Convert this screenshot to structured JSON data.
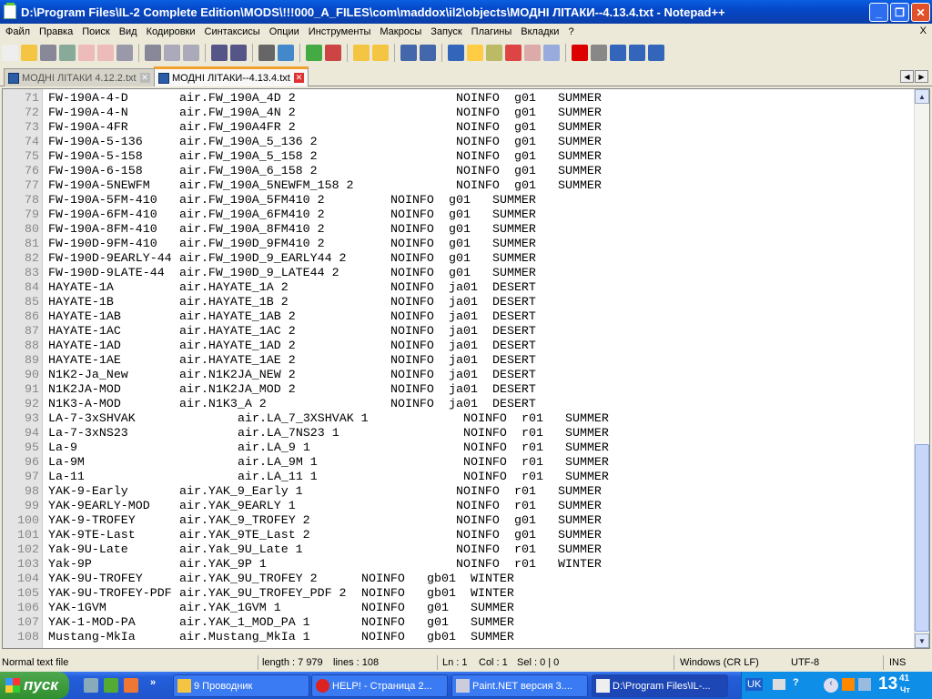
{
  "window": {
    "title": "D:\\Program Files\\IL-2 Complete Edition\\MODS\\!!!000_A_FILES\\com\\maddox\\il2\\objects\\МОДНІ ЛІТАКИ--4.13.4.txt - Notepad++",
    "minimize": "_",
    "restore": "❐",
    "close": "✕"
  },
  "menu": [
    "Файл",
    "Правка",
    "Поиск",
    "Вид",
    "Кодировки",
    "Синтаксисы",
    "Опции",
    "Инструменты",
    "Макросы",
    "Запуск",
    "Плагины",
    "Вкладки",
    "?"
  ],
  "menu_close": "X",
  "toolbar": [
    "new-file",
    "open-file",
    "save",
    "save-all",
    "close",
    "close-all",
    "print",
    "cut",
    "copy",
    "paste",
    "undo",
    "redo",
    "find",
    "replace",
    "zoom-in",
    "zoom-out",
    "sync-vertical",
    "sync-horizontal",
    "word-wrap",
    "show-all-chars",
    "indent-guide",
    "user-lang",
    "doc-map",
    "function-list",
    "folder-workspace",
    "monitor",
    "record-macro",
    "stop-record",
    "play-macro",
    "play-multiple",
    "save-macro"
  ],
  "tabs": [
    {
      "label": "МОДНІ ЛІТАКИ 4.12.2.txt",
      "active": false
    },
    {
      "label": "МОДНІ ЛІТАКИ--4.13.4.txt",
      "active": true
    }
  ],
  "tab_close": "✕",
  "lines": [
    {
      "n": "71",
      "g": "A",
      "f": [
        "FW-190A-4-D",
        "air.FW_190A_4D 2",
        "NOINFO",
        "g01",
        "SUMMER"
      ]
    },
    {
      "n": "72",
      "g": "A",
      "f": [
        "FW-190A-4-N",
        "air.FW_190A_4N 2",
        "NOINFO",
        "g01",
        "SUMMER"
      ]
    },
    {
      "n": "73",
      "g": "A",
      "f": [
        "FW-190A-4FR",
        "air.FW_190A4FR 2",
        "NOINFO",
        "g01",
        "SUMMER"
      ]
    },
    {
      "n": "74",
      "g": "A",
      "f": [
        "FW-190A-5-136",
        "air.FW_190A_5_136 2",
        "NOINFO",
        "g01",
        "SUMMER"
      ]
    },
    {
      "n": "75",
      "g": "A",
      "f": [
        "FW-190A-5-158",
        "air.FW_190A_5_158 2",
        "NOINFO",
        "g01",
        "SUMMER"
      ]
    },
    {
      "n": "76",
      "g": "A",
      "f": [
        "FW-190A-6-158",
        "air.FW_190A_6_158 2",
        "NOINFO",
        "g01",
        "SUMMER"
      ]
    },
    {
      "n": "77",
      "g": "A",
      "f": [
        "FW-190A-5NEWFM",
        "air.FW_190A_5NEWFM_158 2",
        "NOINFO",
        "g01",
        "SUMMER"
      ]
    },
    {
      "n": "78",
      "g": "B",
      "f": [
        "FW-190A-5FM-410",
        "air.FW_190A_5FM410 2",
        "NOINFO",
        "g01",
        "SUMMER"
      ]
    },
    {
      "n": "79",
      "g": "B",
      "f": [
        "FW-190A-6FM-410",
        "air.FW_190A_6FM410 2",
        "NOINFO",
        "g01",
        "SUMMER"
      ]
    },
    {
      "n": "80",
      "g": "B",
      "f": [
        "FW-190A-8FM-410",
        "air.FW_190A_8FM410 2",
        "NOINFO",
        "g01",
        "SUMMER"
      ]
    },
    {
      "n": "81",
      "g": "B",
      "f": [
        "FW-190D-9FM-410",
        "air.FW_190D_9FM410 2",
        "NOINFO",
        "g01",
        "SUMMER"
      ]
    },
    {
      "n": "82",
      "g": "B",
      "f": [
        "FW-190D-9EARLY-44",
        "air.FW_190D_9_EARLY44 2",
        "NOINFO",
        "g01",
        "SUMMER"
      ]
    },
    {
      "n": "83",
      "g": "B",
      "f": [
        "FW-190D-9LATE-44",
        "air.FW_190D_9_LATE44 2",
        "NOINFO",
        "g01",
        "SUMMER"
      ]
    },
    {
      "n": "84",
      "g": "B",
      "f": [
        "HAYATE-1A",
        "air.HAYATE_1A 2",
        "NOINFO",
        "ja01",
        "DESERT"
      ]
    },
    {
      "n": "85",
      "g": "B",
      "f": [
        "HAYATE-1B",
        "air.HAYATE_1B 2",
        "NOINFO",
        "ja01",
        "DESERT"
      ]
    },
    {
      "n": "86",
      "g": "B",
      "f": [
        "HAYATE-1AB",
        "air.HAYATE_1AB 2",
        "NOINFO",
        "ja01",
        "DESERT"
      ]
    },
    {
      "n": "87",
      "g": "B",
      "f": [
        "HAYATE-1AC",
        "air.HAYATE_1AC 2",
        "NOINFO",
        "ja01",
        "DESERT"
      ]
    },
    {
      "n": "88",
      "g": "B",
      "f": [
        "HAYATE-1AD",
        "air.HAYATE_1AD 2",
        "NOINFO",
        "ja01",
        "DESERT"
      ]
    },
    {
      "n": "89",
      "g": "B",
      "f": [
        "HAYATE-1AE",
        "air.HAYATE_1AE 2",
        "NOINFO",
        "ja01",
        "DESERT"
      ]
    },
    {
      "n": "90",
      "g": "B",
      "f": [
        "N1K2-Ja_New",
        "air.N1K2JA_NEW 2",
        "NOINFO",
        "ja01",
        "DESERT"
      ]
    },
    {
      "n": "91",
      "g": "B",
      "f": [
        "N1K2JA-MOD",
        "air.N1K2JA_MOD 2",
        "NOINFO",
        "ja01",
        "DESERT"
      ]
    },
    {
      "n": "92",
      "g": "B",
      "f": [
        "N1K3-A-MOD",
        "air.N1K3_A 2",
        "NOINFO",
        "ja01",
        "DESERT"
      ]
    },
    {
      "n": "93",
      "g": "C",
      "f": [
        "LA-7-3xSHVAK",
        "air.LA_7_3XSHVAK 1",
        "NOINFO",
        "r01",
        "SUMMER"
      ]
    },
    {
      "n": "94",
      "g": "C",
      "f": [
        "La-7-3xNS23",
        "air.LA_7NS23 1",
        "NOINFO",
        "r01",
        "SUMMER"
      ]
    },
    {
      "n": "95",
      "g": "C",
      "f": [
        "La-9",
        "air.LA_9 1",
        "NOINFO",
        "r01",
        "SUMMER"
      ]
    },
    {
      "n": "96",
      "g": "C",
      "f": [
        "La-9M",
        "air.LA_9M 1",
        "NOINFO",
        "r01",
        "SUMMER"
      ]
    },
    {
      "n": "97",
      "g": "C",
      "f": [
        "La-11",
        "air.LA_11 1",
        "NOINFO",
        "r01",
        "SUMMER"
      ]
    },
    {
      "n": "98",
      "g": "A",
      "f": [
        "YAK-9-Early",
        "air.YAK_9_Early 1",
        "NOINFO",
        "r01",
        "SUMMER"
      ]
    },
    {
      "n": "99",
      "g": "A",
      "f": [
        "YAK-9EARLY-MOD",
        "air.YAK_9EARLY 1",
        "NOINFO",
        "r01",
        "SUMMER"
      ]
    },
    {
      "n": "100",
      "g": "A",
      "f": [
        "YAK-9-TROFEY",
        "air.YAK_9_TROFEY 2",
        "NOINFO",
        "g01",
        "SUMMER"
      ]
    },
    {
      "n": "101",
      "g": "A",
      "f": [
        "YAK-9TE-Last",
        "air.YAK_9TE_Last 2",
        "NOINFO",
        "g01",
        "SUMMER"
      ]
    },
    {
      "n": "102",
      "g": "A",
      "f": [
        "Yak-9U-Late",
        "air.Yak_9U_Late 1",
        "NOINFO",
        "r01",
        "SUMMER"
      ]
    },
    {
      "n": "103",
      "g": "A",
      "f": [
        "Yak-9P",
        "air.YAK_9P 1",
        "NOINFO",
        "r01",
        "WINTER"
      ]
    },
    {
      "n": "104",
      "g": "D",
      "f": [
        "YAK-9U-TROFEY",
        "air.YAK_9U_TROFEY 2",
        "NOINFO",
        "gb01",
        "WINTER"
      ]
    },
    {
      "n": "105",
      "g": "D",
      "f": [
        "YAK-9U-TROFEY-PDF",
        "air.YAK_9U_TROFEY_PDF 2",
        "NOINFO",
        "gb01",
        "WINTER"
      ]
    },
    {
      "n": "106",
      "g": "D",
      "f": [
        "YAK-1GVM",
        "air.YAK_1GVM 1",
        "NOINFO",
        "g01",
        "SUMMER"
      ]
    },
    {
      "n": "107",
      "g": "D",
      "f": [
        "YAK-1-MOD-PA",
        "air.YAK_1_MOD_PA 1",
        "NOINFO",
        "g01",
        "SUMMER"
      ]
    },
    {
      "n": "108",
      "g": "D",
      "f": [
        "Mustang-MkIa",
        "air.Mustang_MkIa 1",
        "NOINFO",
        "gb01",
        "SUMMER"
      ]
    }
  ],
  "status": {
    "type": "Normal text file",
    "length": "length : 7 979",
    "lines": "lines : 108",
    "ln": "Ln : 1",
    "col": "Col : 1",
    "sel": "Sel : 0 | 0",
    "eol": "Windows (CR LF)",
    "encoding": "UTF-8",
    "mode": "INS"
  },
  "taskbar": {
    "start": "пуск",
    "more": "»",
    "tasks": [
      "9 Проводник",
      "HELP! - Страница 2...",
      "Paint.NET версия 3....",
      "D:\\Program Files\\IL-..."
    ],
    "lang": "UK",
    "clock_h": "13",
    "clock_m": "41",
    "clock_day": "Чт"
  }
}
